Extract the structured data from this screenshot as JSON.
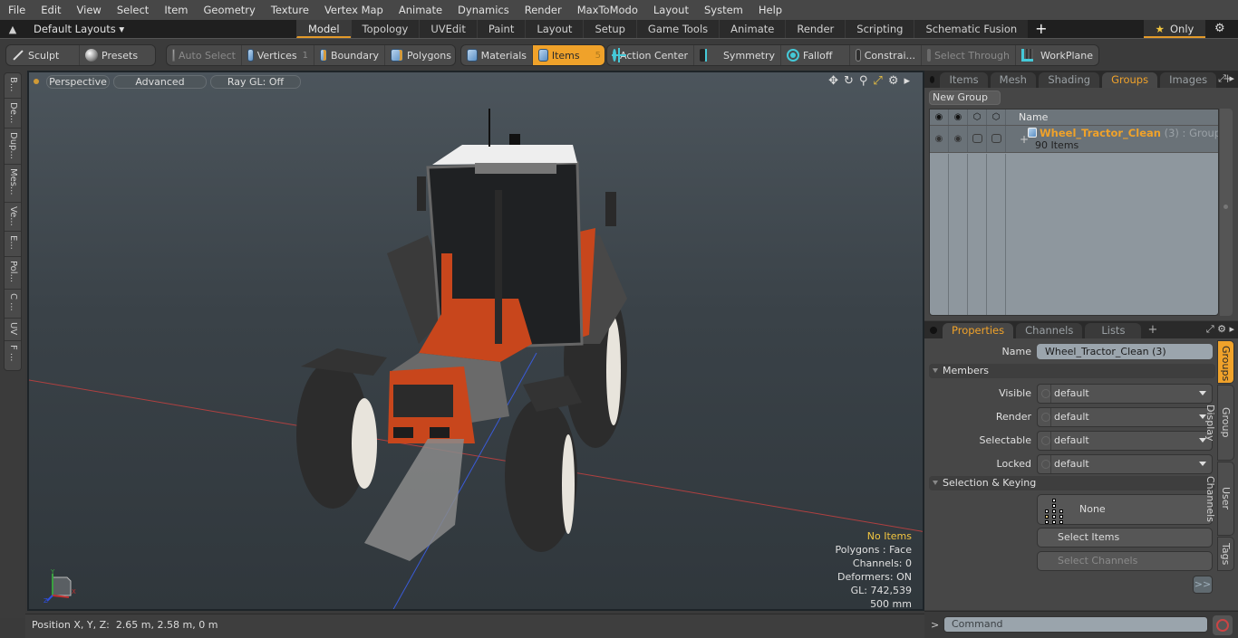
{
  "menu": [
    "File",
    "Edit",
    "View",
    "Select",
    "Item",
    "Geometry",
    "Texture",
    "Vertex Map",
    "Animate",
    "Dynamics",
    "Render",
    "MaxToModo",
    "Layout",
    "System",
    "Help"
  ],
  "layout_bar": {
    "layouts_label": "Default Layouts ▾",
    "tabs": [
      {
        "label": "Model",
        "active": true
      },
      {
        "label": "Topology"
      },
      {
        "label": "UVEdit"
      },
      {
        "label": "Paint"
      },
      {
        "label": "Layout"
      },
      {
        "label": "Setup"
      },
      {
        "label": "Game Tools"
      },
      {
        "label": "Animate"
      },
      {
        "label": "Render"
      },
      {
        "label": "Scripting"
      },
      {
        "label": "Schematic Fusion"
      }
    ],
    "add_tab": "+",
    "only_label": "Only",
    "star_glyph": "★",
    "gear_glyph": "⚙"
  },
  "toolbar": {
    "sculpt": "Sculpt",
    "presets": "Presets",
    "auto_select": "Auto Select",
    "vertices": "Vertices",
    "vertices_count": "1",
    "boundary": "Boundary",
    "polygons": "Polygons",
    "materials": "Materials",
    "items": "Items",
    "items_count": "5",
    "action_center": "Action Center",
    "symmetry": "Symmetry",
    "falloff": "Falloff",
    "constraints": "Constrai...",
    "select_through": "Select Through",
    "workplane": "WorkPlane"
  },
  "left_tabs": [
    "B...",
    "De...",
    "Dup...",
    "Mes...",
    "Ve...",
    "E...",
    "Pol...",
    "C ...",
    "UV",
    "F ..."
  ],
  "viewport": {
    "view_mode": "Perspective",
    "shading": "Advanced",
    "raygl": "Ray GL: Off",
    "icons": [
      "move-icon",
      "rotate-icon",
      "zoom-icon",
      "maximize-icon",
      "gear-icon",
      "arrow-right-icon"
    ],
    "stats": {
      "selection": "No Items",
      "polygons": "Polygons : Face",
      "channels": "Channels: 0",
      "deformers": "Deformers: ON",
      "gl": "GL: 742,539",
      "scale": "500 mm"
    },
    "axis_labels": {
      "x": "X",
      "y": "Y",
      "z": "Z"
    }
  },
  "status_bar": {
    "label": "Position X, Y, Z:",
    "value": "2.65 m, 2.58 m, 0 m"
  },
  "top_panel": {
    "tabs": [
      {
        "label": "Items"
      },
      {
        "label": "Mesh ..."
      },
      {
        "label": "Shading"
      },
      {
        "label": "Groups",
        "active": true
      },
      {
        "label": "Images"
      }
    ],
    "add_tab": "+",
    "new_group": "New Group",
    "column_name": "Name",
    "group": {
      "name": "Wheel_Tractor_Clean",
      "suffix": " (3) : Group",
      "count": "90 Items"
    }
  },
  "bottom_panel": {
    "tabs": [
      {
        "label": "Properties",
        "active": true
      },
      {
        "label": "Channels"
      },
      {
        "label": "Lists"
      }
    ],
    "add_tab": "+",
    "name_label": "Name",
    "name_value": "Wheel_Tractor_Clean (3)",
    "members_section": "Members",
    "fields": [
      {
        "label": "Visible",
        "value": "default"
      },
      {
        "label": "Render",
        "value": "default"
      },
      {
        "label": "Selectable",
        "value": "default"
      },
      {
        "label": "Locked",
        "value": "default"
      }
    ],
    "selection_section": "Selection & Keying",
    "keying_value": "None",
    "select_items": "Select Items",
    "select_channels": "Select Channels",
    "more": ">>",
    "side_tabs": [
      {
        "label": "Groups",
        "active": true
      },
      {
        "label": "Group Display"
      },
      {
        "label": "User Channels"
      },
      {
        "label": "Tags"
      }
    ]
  },
  "command_bar": {
    "prompt": ">",
    "placeholder": "Command"
  },
  "colors": {
    "accent": "#f0a22a",
    "tractor_orange": "#c8461c",
    "cyan_icon": "#45c9d8"
  }
}
